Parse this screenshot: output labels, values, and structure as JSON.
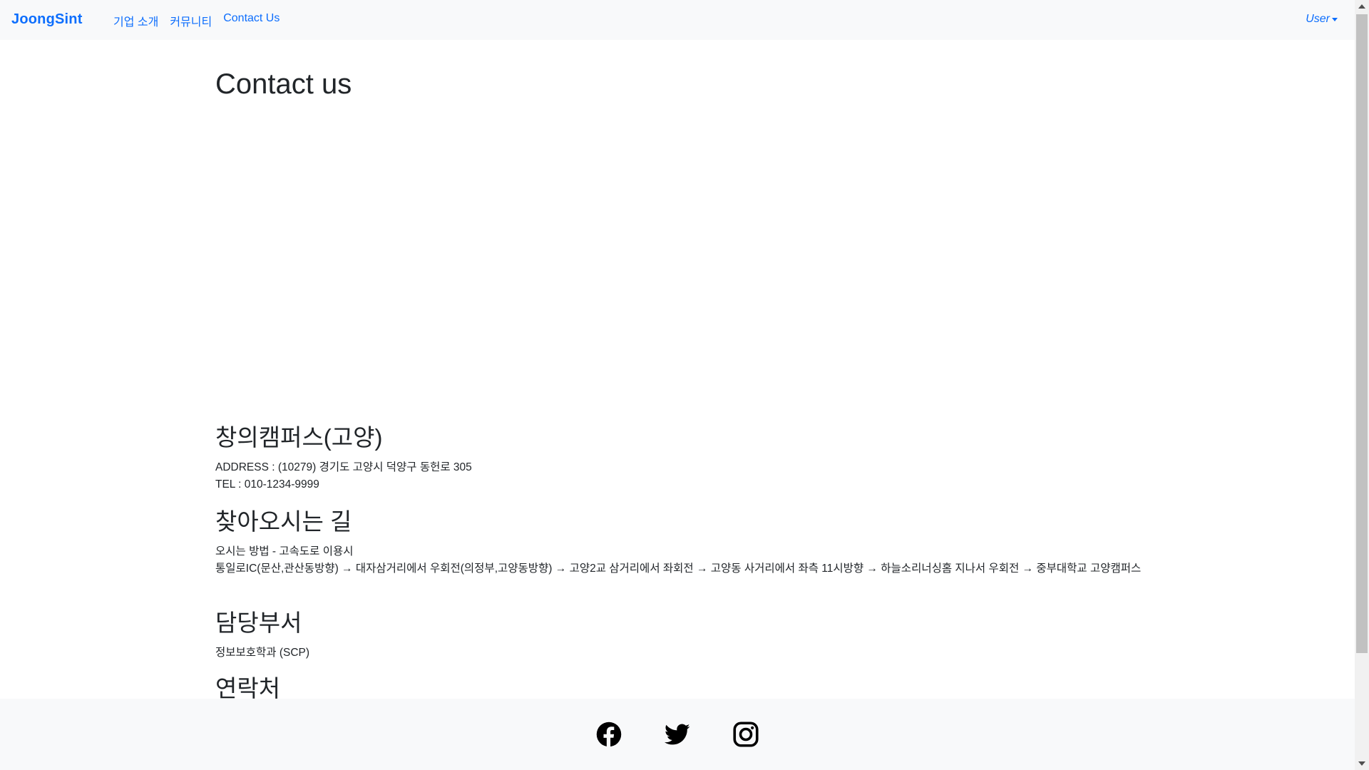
{
  "nav": {
    "brand": "JoongSint",
    "links": [
      "기업 소개",
      "커뮤니티",
      "Contact Us"
    ],
    "user": "User"
  },
  "main": {
    "title": "Contact us",
    "campus": {
      "heading": "창의캠퍼스(고양)",
      "address": "ADDRESS : (10279) 경기도 고양시 덕양구 동헌로 305",
      "tel": "TEL : 010-1234-9999"
    },
    "directions": {
      "heading": "찾아오시는 길",
      "method": "오시는 방법 - 고속도로 이용시",
      "route": "통일로IC(문산,관산동방향) → 대자삼거리에서 우회전(의정부,고양동방향) → 고양2교 삼거리에서 좌회전 → 고양동 사거리에서 좌측 11시방향 → 하늘소리너싱홈 지나서 우회전 → 중부대학교 고양캠퍼스"
    },
    "department": {
      "heading": "담당부서",
      "name": "정보보호학과 (SCP)"
    },
    "contact": {
      "heading": "연락처"
    }
  },
  "footer": {
    "icons": [
      "facebook-icon",
      "twitter-icon",
      "instagram-icon"
    ]
  },
  "colors": {
    "accent": "#0d6efd",
    "navbar_bg": "#f8f9fa",
    "text": "#212529"
  }
}
